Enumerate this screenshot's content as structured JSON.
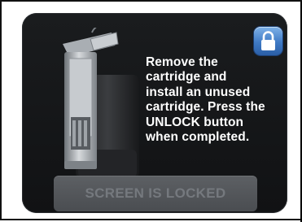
{
  "screen": {
    "instruction_text": "Remove the\ncartridge and\ninstall an unused\ncartridge. Press the\nUNLOCK button\nwhen completed.",
    "lock_icon": "padlock-icon",
    "status_label": "SCREEN IS LOCKED",
    "device_image": "cartridge-device-illustration"
  },
  "colors": {
    "screen_background": "#151719",
    "text": "#ffffff",
    "lock_button": "#3f7ac5",
    "status_bar": "#54575b",
    "status_text": "#75797e"
  }
}
